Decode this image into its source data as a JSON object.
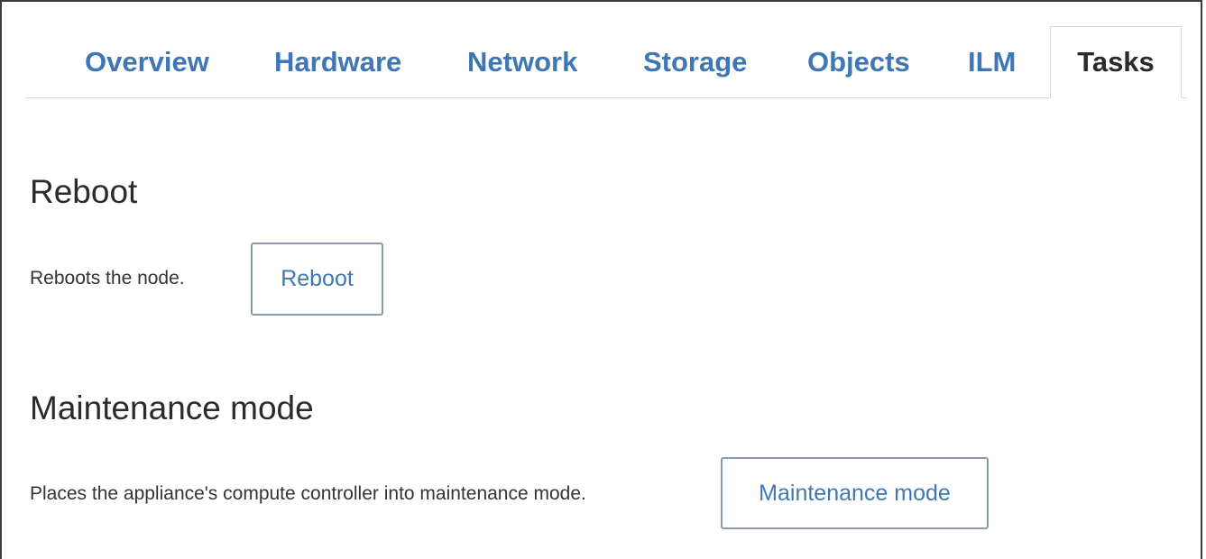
{
  "tabs": [
    {
      "label": "Overview",
      "active": false
    },
    {
      "label": "Hardware",
      "active": false
    },
    {
      "label": "Network",
      "active": false
    },
    {
      "label": "Storage",
      "active": false
    },
    {
      "label": "Objects",
      "active": false
    },
    {
      "label": "ILM",
      "active": false
    },
    {
      "label": "Tasks",
      "active": true
    }
  ],
  "colors": {
    "link": "#3f77b5",
    "text": "#2b2b2b",
    "border": "#d6d6d6"
  },
  "sections": {
    "reboot": {
      "title": "Reboot",
      "description": "Reboots the node.",
      "button_label": "Reboot"
    },
    "maintenance": {
      "title": "Maintenance mode",
      "description": "Places the appliance's compute controller into maintenance mode.",
      "button_label": "Maintenance mode"
    }
  }
}
